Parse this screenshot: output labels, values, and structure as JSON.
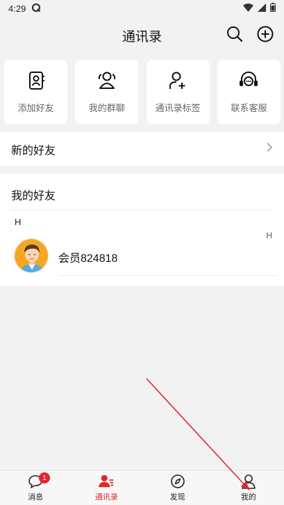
{
  "status_bar": {
    "time": "4:29"
  },
  "header": {
    "title": "通讯录",
    "search_icon": "search-icon",
    "add_icon": "plus-circle-icon"
  },
  "cards": [
    {
      "label": "添加好友",
      "icon": "contact-book-icon"
    },
    {
      "label": "我的群聊",
      "icon": "group-icon"
    },
    {
      "label": "通讯录标签",
      "icon": "tag-user-icon"
    },
    {
      "label": "联系客服",
      "icon": "headset-chat-icon"
    }
  ],
  "new_friends": {
    "label": "新的好友"
  },
  "friends": {
    "title": "我的好友",
    "group_letter": "H",
    "index_letter": "H",
    "items": [
      {
        "name": "会员824818"
      }
    ]
  },
  "tabbar": {
    "tabs": [
      {
        "label": "消息",
        "icon": "chat-bubble-icon",
        "badge": "1"
      },
      {
        "label": "通讯录",
        "icon": "contacts-icon"
      },
      {
        "label": "发现",
        "icon": "compass-icon"
      },
      {
        "label": "我的",
        "icon": "user-icon"
      }
    ]
  },
  "colors": {
    "accent": "#e0262e",
    "background": "#f2f2f2",
    "card": "#ffffff"
  }
}
